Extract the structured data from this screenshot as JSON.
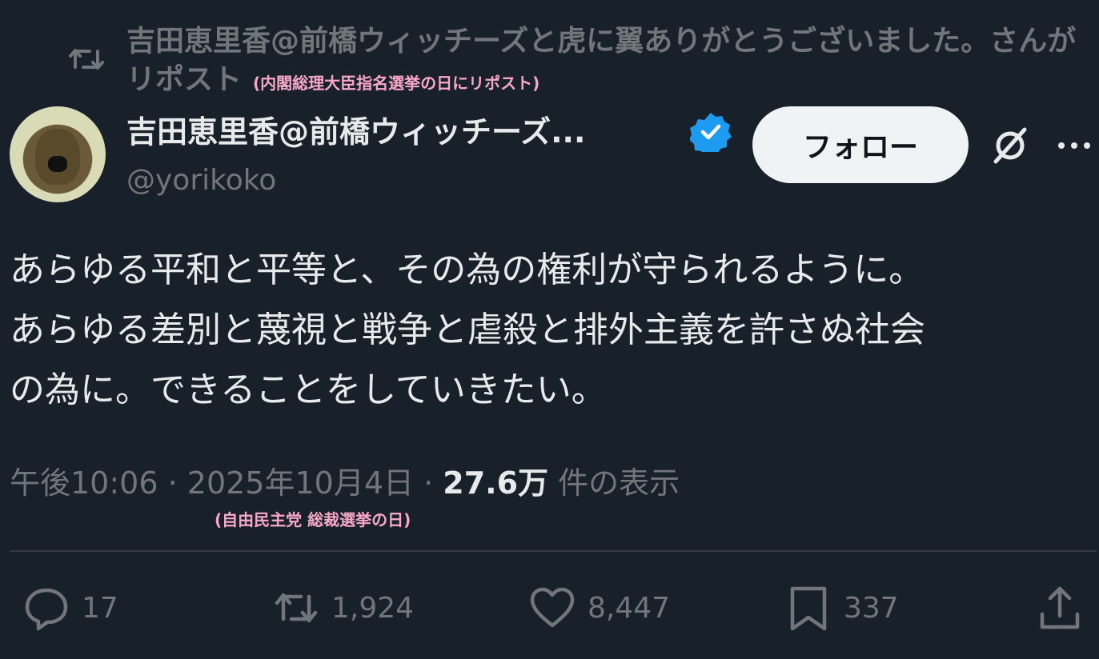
{
  "repost": {
    "text": "吉田恵里香@前橋ウィッチーズと虎に翼ありがとうございました。さんがリポスト",
    "note": "(内閣総理大臣指名選挙の日にリポスト)"
  },
  "author": {
    "display_name": "吉田恵里香@前橋ウィッチーズ...",
    "handle": "@yorikoko",
    "follow_label": "フォロー"
  },
  "tweet": {
    "lines": [
      "あらゆる平和と平等と、その為の権利が守られるように。",
      "あらゆる差別と蔑視と戦争と虐殺と排外主義を許さぬ社会",
      "の為に。できることをしていきたい。"
    ]
  },
  "meta": {
    "time": "午後10:06",
    "sep": " · ",
    "date": "2025年10月4日",
    "views_count": "27.6万",
    "views_label": " 件の表示",
    "note": "(自由民主党 総裁選挙の日)"
  },
  "actions": {
    "replies": "17",
    "retweets": "1,924",
    "likes": "8,447",
    "bookmarks": "337"
  },
  "colors": {
    "background": "#18202a",
    "text_primary": "#e7e9ea",
    "text_secondary": "#71767b",
    "verified": "#1d9bf0",
    "annotation": "#f9a8c9"
  },
  "icons": [
    "repost-icon",
    "verified-icon",
    "grok-icon",
    "more-icon",
    "reply-icon",
    "retweet-icon",
    "like-icon",
    "bookmark-icon",
    "share-icon"
  ]
}
